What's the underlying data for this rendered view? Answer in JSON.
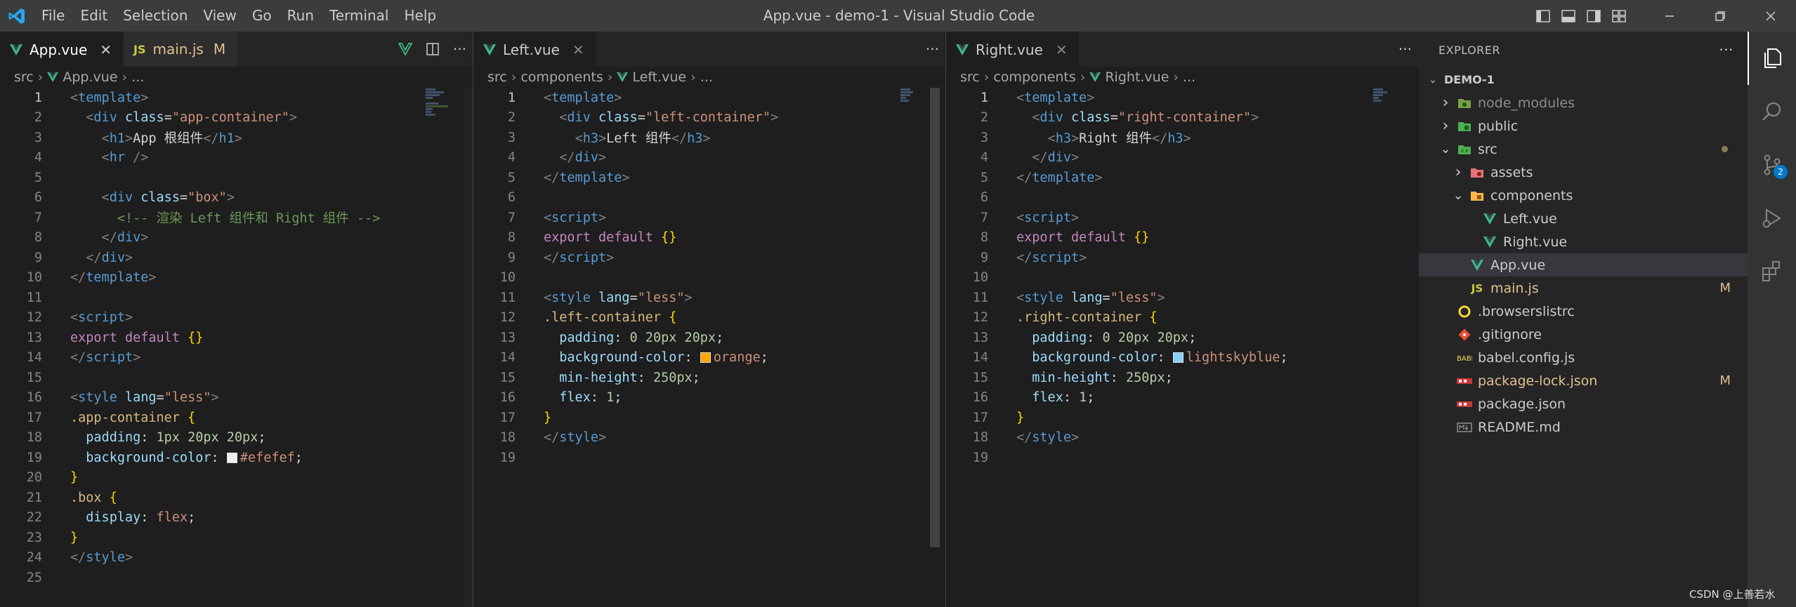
{
  "menu": [
    "File",
    "Edit",
    "Selection",
    "View",
    "Go",
    "Run",
    "Terminal",
    "Help"
  ],
  "window_title": "App.vue - demo-1 - Visual Studio Code",
  "groups": {
    "app": {
      "tabs": [
        {
          "label": "App.vue",
          "icon": "vue-icon"
        },
        {
          "label": "main.js",
          "icon_text": "JS",
          "modified": "M"
        }
      ],
      "breadcrumb": [
        "src",
        "App.vue",
        "..."
      ]
    },
    "left": {
      "tabs": [
        {
          "label": "Left.vue",
          "icon": "vue-icon"
        }
      ],
      "breadcrumb": [
        "src",
        "components",
        "Left.vue",
        "..."
      ]
    },
    "right": {
      "tabs": [
        {
          "label": "Right.vue",
          "icon": "vue-icon"
        }
      ],
      "breadcrumb": [
        "src",
        "components",
        "Right.vue",
        "..."
      ]
    }
  },
  "code": {
    "app": [
      [
        [
          "t-br",
          "<"
        ],
        [
          "t-tag",
          "template"
        ],
        [
          "t-br",
          ">"
        ]
      ],
      [
        [
          "t-text",
          "  "
        ],
        [
          "t-br",
          "<"
        ],
        [
          "t-tag",
          "div"
        ],
        [
          "t-text",
          " "
        ],
        [
          "t-attr",
          "class"
        ],
        [
          "t-text",
          "="
        ],
        [
          "t-str",
          "\"app-container\""
        ],
        [
          "t-br",
          ">"
        ]
      ],
      [
        [
          "t-text",
          "    "
        ],
        [
          "t-br",
          "<"
        ],
        [
          "t-tag",
          "h1"
        ],
        [
          "t-br",
          ">"
        ],
        [
          "t-text",
          "App 根组件"
        ],
        [
          "t-br",
          "</"
        ],
        [
          "t-tag",
          "h1"
        ],
        [
          "t-br",
          ">"
        ]
      ],
      [
        [
          "t-text",
          "    "
        ],
        [
          "t-br",
          "<"
        ],
        [
          "t-tag",
          "hr"
        ],
        [
          "t-text",
          " "
        ],
        [
          "t-br",
          "/>"
        ]
      ],
      [],
      [
        [
          "t-text",
          "    "
        ],
        [
          "t-br",
          "<"
        ],
        [
          "t-tag",
          "div"
        ],
        [
          "t-text",
          " "
        ],
        [
          "t-attr",
          "class"
        ],
        [
          "t-text",
          "="
        ],
        [
          "t-str",
          "\"box\""
        ],
        [
          "t-br",
          ">"
        ]
      ],
      [
        [
          "t-text",
          "      "
        ],
        [
          "t-cmt",
          "<!-- 渲染 Left 组件和 Right 组件 -->"
        ]
      ],
      [
        [
          "t-text",
          "    "
        ],
        [
          "t-br",
          "</"
        ],
        [
          "t-tag",
          "div"
        ],
        [
          "t-br",
          ">"
        ]
      ],
      [
        [
          "t-text",
          "  "
        ],
        [
          "t-br",
          "</"
        ],
        [
          "t-tag",
          "div"
        ],
        [
          "t-br",
          ">"
        ]
      ],
      [
        [
          "t-br",
          "</"
        ],
        [
          "t-tag",
          "template"
        ],
        [
          "t-br",
          ">"
        ]
      ],
      [],
      [
        [
          "t-br",
          "<"
        ],
        [
          "t-tag",
          "script"
        ],
        [
          "t-br",
          ">"
        ]
      ],
      [
        [
          "t-kw",
          "export"
        ],
        [
          "t-text",
          " "
        ],
        [
          "t-kw",
          "default"
        ],
        [
          "t-text",
          " "
        ],
        [
          "t-brace",
          "{}"
        ]
      ],
      [
        [
          "t-br",
          "</"
        ],
        [
          "t-tag",
          "script"
        ],
        [
          "t-br",
          ">"
        ]
      ],
      [],
      [
        [
          "t-br",
          "<"
        ],
        [
          "t-tag",
          "style"
        ],
        [
          "t-text",
          " "
        ],
        [
          "t-attr",
          "lang"
        ],
        [
          "t-text",
          "="
        ],
        [
          "t-str",
          "\"less\""
        ],
        [
          "t-br",
          ">"
        ]
      ],
      [
        [
          "t-sel",
          ".app-container"
        ],
        [
          "t-text",
          " "
        ],
        [
          "t-brace",
          "{"
        ]
      ],
      [
        [
          "t-text",
          "  "
        ],
        [
          "t-prop",
          "padding"
        ],
        [
          "t-text",
          ": "
        ],
        [
          "t-num",
          "1px 20px 20px"
        ],
        [
          "t-text",
          ";"
        ]
      ],
      [
        [
          "t-text",
          "  "
        ],
        [
          "t-prop",
          "background-color"
        ],
        [
          "t-text",
          ": "
        ],
        [
          "swatch",
          "#efefef"
        ],
        [
          "t-val",
          "#efefef"
        ],
        [
          "t-text",
          ";"
        ]
      ],
      [
        [
          "t-brace",
          "}"
        ]
      ],
      [
        [
          "t-sel",
          ".box"
        ],
        [
          "t-text",
          " "
        ],
        [
          "t-brace",
          "{"
        ]
      ],
      [
        [
          "t-text",
          "  "
        ],
        [
          "t-prop",
          "display"
        ],
        [
          "t-text",
          ": "
        ],
        [
          "t-val",
          "flex"
        ],
        [
          "t-text",
          ";"
        ]
      ],
      [
        [
          "t-brace",
          "}"
        ]
      ],
      [
        [
          "t-br",
          "</"
        ],
        [
          "t-tag",
          "style"
        ],
        [
          "t-br",
          ">"
        ]
      ],
      []
    ],
    "left": [
      [
        [
          "t-br",
          "<"
        ],
        [
          "t-tag",
          "template"
        ],
        [
          "t-br",
          ">"
        ]
      ],
      [
        [
          "t-text",
          "  "
        ],
        [
          "t-br",
          "<"
        ],
        [
          "t-tag",
          "div"
        ],
        [
          "t-text",
          " "
        ],
        [
          "t-attr",
          "class"
        ],
        [
          "t-text",
          "="
        ],
        [
          "t-str",
          "\"left-container\""
        ],
        [
          "t-br",
          ">"
        ]
      ],
      [
        [
          "t-text",
          "    "
        ],
        [
          "t-br",
          "<"
        ],
        [
          "t-tag",
          "h3"
        ],
        [
          "t-br",
          ">"
        ],
        [
          "t-text",
          "Left 组件"
        ],
        [
          "t-br",
          "</"
        ],
        [
          "t-tag",
          "h3"
        ],
        [
          "t-br",
          ">"
        ]
      ],
      [
        [
          "t-text",
          "  "
        ],
        [
          "t-br",
          "</"
        ],
        [
          "t-tag",
          "div"
        ],
        [
          "t-br",
          ">"
        ]
      ],
      [
        [
          "t-br",
          "</"
        ],
        [
          "t-tag",
          "template"
        ],
        [
          "t-br",
          ">"
        ]
      ],
      [],
      [
        [
          "t-br",
          "<"
        ],
        [
          "t-tag",
          "script"
        ],
        [
          "t-br",
          ">"
        ]
      ],
      [
        [
          "t-kw",
          "export"
        ],
        [
          "t-text",
          " "
        ],
        [
          "t-kw",
          "default"
        ],
        [
          "t-text",
          " "
        ],
        [
          "t-brace",
          "{}"
        ]
      ],
      [
        [
          "t-br",
          "</"
        ],
        [
          "t-tag",
          "script"
        ],
        [
          "t-br",
          ">"
        ]
      ],
      [],
      [
        [
          "t-br",
          "<"
        ],
        [
          "t-tag",
          "style"
        ],
        [
          "t-text",
          " "
        ],
        [
          "t-attr",
          "lang"
        ],
        [
          "t-text",
          "="
        ],
        [
          "t-str",
          "\"less\""
        ],
        [
          "t-br",
          ">"
        ]
      ],
      [
        [
          "t-sel",
          ".left-container"
        ],
        [
          "t-text",
          " "
        ],
        [
          "t-brace",
          "{"
        ]
      ],
      [
        [
          "t-text",
          "  "
        ],
        [
          "t-prop",
          "padding"
        ],
        [
          "t-text",
          ": "
        ],
        [
          "t-num",
          "0 20px 20px"
        ],
        [
          "t-text",
          ";"
        ]
      ],
      [
        [
          "t-text",
          "  "
        ],
        [
          "t-prop",
          "background-color"
        ],
        [
          "t-text",
          ": "
        ],
        [
          "swatch",
          "orange"
        ],
        [
          "t-val",
          "orange"
        ],
        [
          "t-text",
          ";"
        ]
      ],
      [
        [
          "t-text",
          "  "
        ],
        [
          "t-prop",
          "min-height"
        ],
        [
          "t-text",
          ": "
        ],
        [
          "t-num",
          "250px"
        ],
        [
          "t-text",
          ";"
        ]
      ],
      [
        [
          "t-text",
          "  "
        ],
        [
          "t-prop",
          "flex"
        ],
        [
          "t-text",
          ": "
        ],
        [
          "t-num",
          "1"
        ],
        [
          "t-text",
          ";"
        ]
      ],
      [
        [
          "t-brace",
          "}"
        ]
      ],
      [
        [
          "t-br",
          "</"
        ],
        [
          "t-tag",
          "style"
        ],
        [
          "t-br",
          ">"
        ]
      ],
      []
    ],
    "right": [
      [
        [
          "t-br",
          "<"
        ],
        [
          "t-tag",
          "template"
        ],
        [
          "t-br",
          ">"
        ]
      ],
      [
        [
          "t-text",
          "  "
        ],
        [
          "t-br",
          "<"
        ],
        [
          "t-tag",
          "div"
        ],
        [
          "t-text",
          " "
        ],
        [
          "t-attr",
          "class"
        ],
        [
          "t-text",
          "="
        ],
        [
          "t-str",
          "\"right-container\""
        ],
        [
          "t-br",
          ">"
        ]
      ],
      [
        [
          "t-text",
          "    "
        ],
        [
          "t-br",
          "<"
        ],
        [
          "t-tag",
          "h3"
        ],
        [
          "t-br",
          ">"
        ],
        [
          "t-text",
          "Right 组件"
        ],
        [
          "t-br",
          "</"
        ],
        [
          "t-tag",
          "h3"
        ],
        [
          "t-br",
          ">"
        ]
      ],
      [
        [
          "t-text",
          "  "
        ],
        [
          "t-br",
          "</"
        ],
        [
          "t-tag",
          "div"
        ],
        [
          "t-br",
          ">"
        ]
      ],
      [
        [
          "t-br",
          "</"
        ],
        [
          "t-tag",
          "template"
        ],
        [
          "t-br",
          ">"
        ]
      ],
      [],
      [
        [
          "t-br",
          "<"
        ],
        [
          "t-tag",
          "script"
        ],
        [
          "t-br",
          ">"
        ]
      ],
      [
        [
          "t-kw",
          "export"
        ],
        [
          "t-text",
          " "
        ],
        [
          "t-kw",
          "default"
        ],
        [
          "t-text",
          " "
        ],
        [
          "t-brace",
          "{}"
        ]
      ],
      [
        [
          "t-br",
          "</"
        ],
        [
          "t-tag",
          "script"
        ],
        [
          "t-br",
          ">"
        ]
      ],
      [],
      [
        [
          "t-br",
          "<"
        ],
        [
          "t-tag",
          "style"
        ],
        [
          "t-text",
          " "
        ],
        [
          "t-attr",
          "lang"
        ],
        [
          "t-text",
          "="
        ],
        [
          "t-str",
          "\"less\""
        ],
        [
          "t-br",
          ">"
        ]
      ],
      [
        [
          "t-sel",
          ".right-container"
        ],
        [
          "t-text",
          " "
        ],
        [
          "t-brace",
          "{"
        ]
      ],
      [
        [
          "t-text",
          "  "
        ],
        [
          "t-prop",
          "padding"
        ],
        [
          "t-text",
          ": "
        ],
        [
          "t-num",
          "0 20px 20px"
        ],
        [
          "t-text",
          ";"
        ]
      ],
      [
        [
          "t-text",
          "  "
        ],
        [
          "t-prop",
          "background-color"
        ],
        [
          "t-text",
          ": "
        ],
        [
          "swatch",
          "lightskyblue"
        ],
        [
          "t-val",
          "lightskyblue"
        ],
        [
          "t-text",
          ";"
        ]
      ],
      [
        [
          "t-text",
          "  "
        ],
        [
          "t-prop",
          "min-height"
        ],
        [
          "t-text",
          ": "
        ],
        [
          "t-num",
          "250px"
        ],
        [
          "t-text",
          ";"
        ]
      ],
      [
        [
          "t-text",
          "  "
        ],
        [
          "t-prop",
          "flex"
        ],
        [
          "t-text",
          ": "
        ],
        [
          "t-num",
          "1"
        ],
        [
          "t-text",
          ";"
        ]
      ],
      [
        [
          "t-brace",
          "}"
        ]
      ],
      [
        [
          "t-br",
          "</"
        ],
        [
          "t-tag",
          "style"
        ],
        [
          "t-br",
          ">"
        ]
      ],
      []
    ]
  },
  "explorer": {
    "title": "EXPLORER",
    "root": "DEMO-1",
    "items": [
      {
        "label": "node_modules",
        "type": "folder",
        "depth": 1,
        "icon": "node-modules-folder-icon",
        "dim": true
      },
      {
        "label": "public",
        "type": "folder",
        "depth": 1,
        "icon": "public-folder-icon"
      },
      {
        "label": "src",
        "type": "folder-open",
        "depth": 1,
        "icon": "src-folder-icon",
        "dot": true
      },
      {
        "label": "assets",
        "type": "folder",
        "depth": 2,
        "icon": "assets-folder-icon"
      },
      {
        "label": "components",
        "type": "folder-open",
        "depth": 2,
        "icon": "components-folder-icon"
      },
      {
        "label": "Left.vue",
        "type": "file",
        "depth": 3,
        "icon": "vue-file-icon"
      },
      {
        "label": "Right.vue",
        "type": "file",
        "depth": 3,
        "icon": "vue-file-icon"
      },
      {
        "label": "App.vue",
        "type": "file",
        "depth": 2,
        "icon": "vue-file-icon",
        "selected": true
      },
      {
        "label": "main.js",
        "type": "file",
        "depth": 2,
        "icon": "js-file-icon",
        "icon_text": "JS",
        "badge": "M",
        "modified": true
      },
      {
        "label": ".browserslistrc",
        "type": "file",
        "depth": 1,
        "icon": "browserslist-file-icon"
      },
      {
        "label": ".gitignore",
        "type": "file",
        "depth": 1,
        "icon": "git-file-icon"
      },
      {
        "label": "babel.config.js",
        "type": "file",
        "depth": 1,
        "icon": "babel-file-icon"
      },
      {
        "label": "package-lock.json",
        "type": "file",
        "depth": 1,
        "icon": "npm-file-icon",
        "badge": "M",
        "modified": true
      },
      {
        "label": "package.json",
        "type": "file",
        "depth": 1,
        "icon": "npm-file-icon"
      },
      {
        "label": "README.md",
        "type": "file",
        "depth": 1,
        "icon": "markdown-file-icon"
      }
    ]
  },
  "activity": {
    "source_control_badge": "2"
  },
  "watermark": "CSDN @上善若水",
  "colors": {
    "vue_green": "#41b883",
    "modified": "#e2c08d",
    "accent": "#007acc"
  }
}
